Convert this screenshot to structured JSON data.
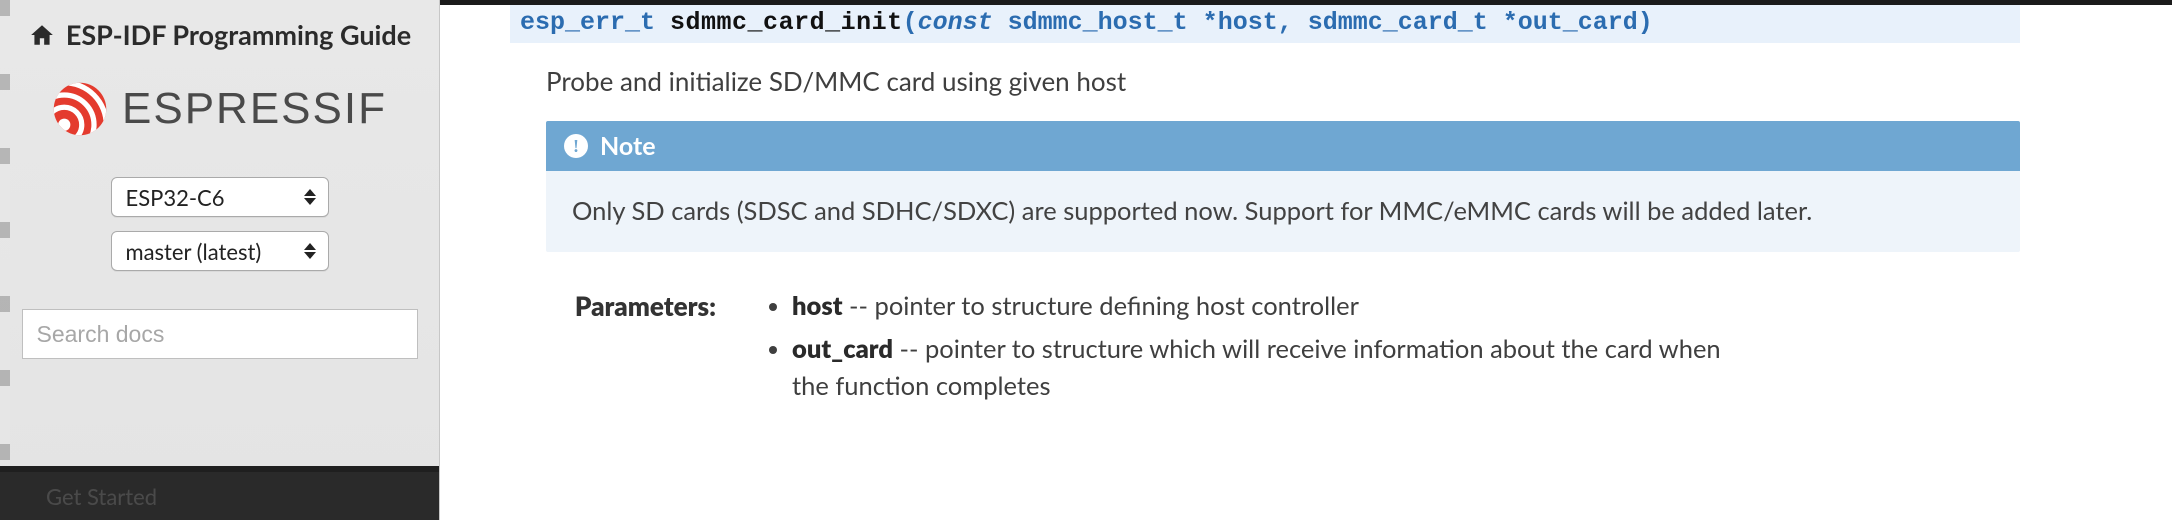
{
  "sidebar": {
    "title": "ESP-IDF Programming Guide",
    "logo_text": "ESPRESSIF",
    "target_select": "ESP32-C6",
    "version_select": "master (latest)",
    "search_placeholder": "Search docs",
    "nav_first_item": "Get Started"
  },
  "api": {
    "signature": {
      "return_type": "esp_err_t",
      "name": "sdmmc_card_init",
      "open": "(",
      "const_kw": "const",
      "param1_type": "sdmmc_host_t",
      "param1_ptr": " *",
      "param1_name": "host",
      "comma": ", ",
      "param2_type": "sdmmc_card_t",
      "param2_ptr": " *",
      "param2_name": "out_card",
      "close": ")"
    },
    "description": "Probe and initialize SD/MMC card using given host",
    "note": {
      "title": "Note",
      "body": "Only SD cards (SDSC and SDHC/SDXC) are supported now. Support for MMC/eMMC cards will be added later."
    },
    "parameters_label": "Parameters:",
    "parameters": [
      {
        "name": "host",
        "sep": " -- ",
        "desc": "pointer to structure defining host controller"
      },
      {
        "name": "out_card",
        "sep": " -- ",
        "desc": "pointer to structure which will receive information about the card when the function completes"
      }
    ]
  }
}
